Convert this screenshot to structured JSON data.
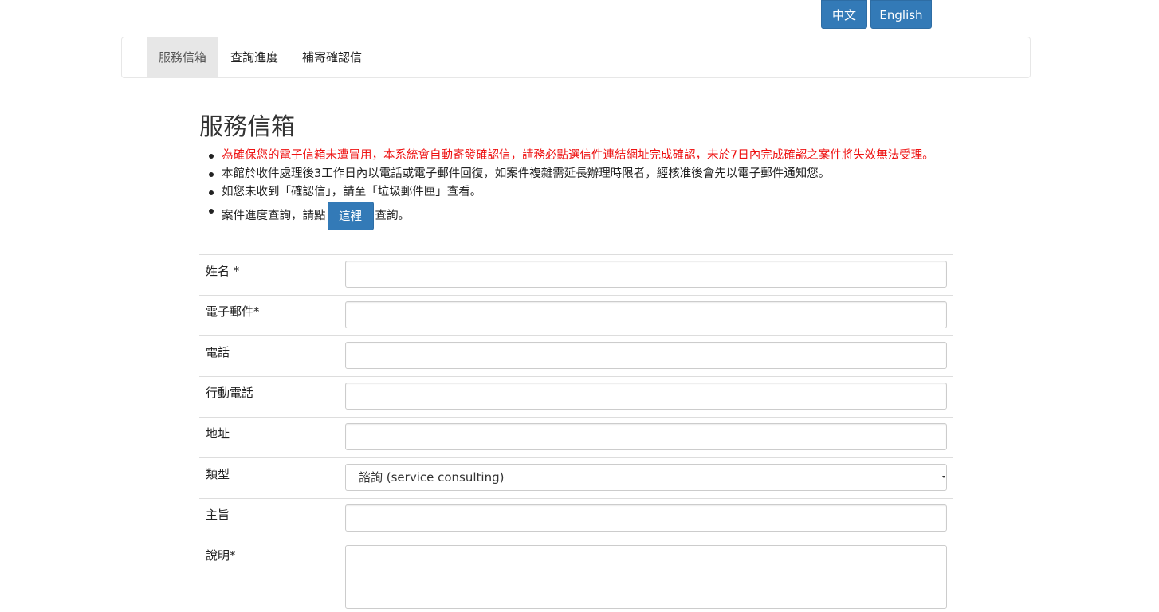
{
  "lang": {
    "zh_label": "中文",
    "en_label": "English"
  },
  "nav": {
    "items": [
      {
        "label": "服務信箱",
        "active": true
      },
      {
        "label": "查詢進度",
        "active": false
      },
      {
        "label": "補寄確認信",
        "active": false
      }
    ]
  },
  "page": {
    "title": "服務信箱",
    "notes": {
      "warning": "為確保您的電子信箱未遭冒用，本系統會自動寄發確認信，請務必點選信件連結網址完成確認，未於7日內完成確認之案件將失效無法受理。",
      "reply": "本館於收件處理後3工作日內以電話或電子郵件回復，如案件複雜需延長辦理時限者，經核准後會先以電子郵件通知您。",
      "spam": "如您未收到「確認信」，請至「垃圾郵件匣」查看。",
      "progress_prefix": "案件進度查詢，請點",
      "progress_button": "這裡",
      "progress_suffix": "查詢。"
    }
  },
  "form": {
    "name_label": "姓名 *",
    "name_value": "",
    "email_label": "電子郵件*",
    "email_value": "",
    "phone_label": "電話",
    "phone_value": "",
    "mobile_label": "行動電話",
    "mobile_value": "",
    "address_label": "地址",
    "address_value": "",
    "type_label": "類型",
    "type_selected": "諮詢 (service consulting)",
    "subject_label": "主旨",
    "subject_value": "",
    "desc_label": "說明*",
    "desc_value": ""
  },
  "colors": {
    "primary": "#337ab7",
    "warning_text": "#ee1111",
    "nav_active_bg": "#e7e7e7"
  }
}
